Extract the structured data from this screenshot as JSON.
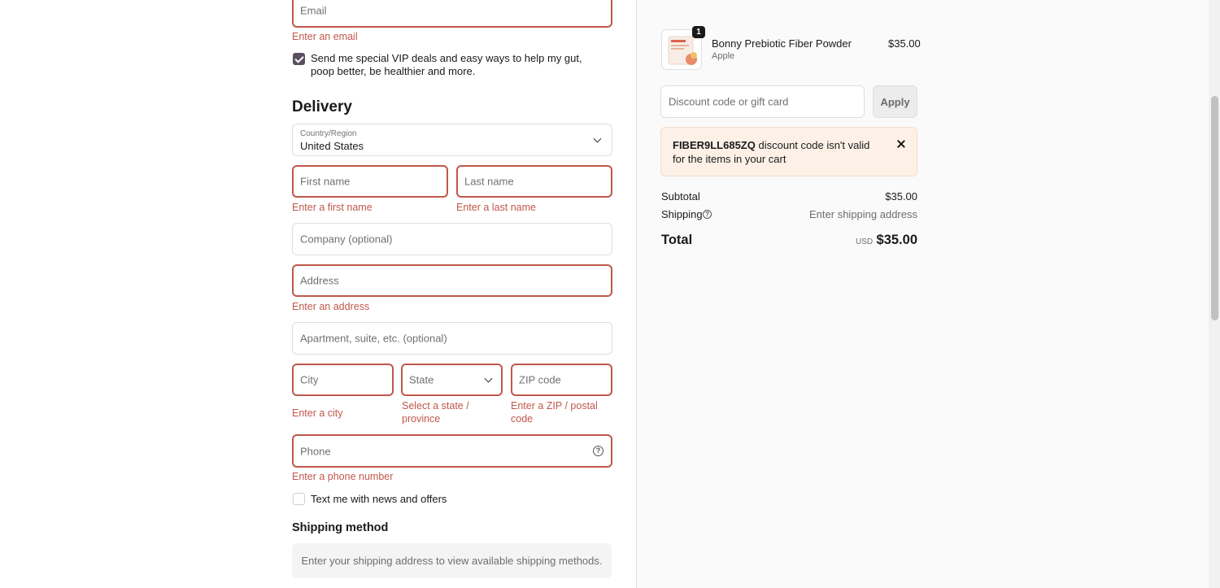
{
  "contact": {
    "email_placeholder": "Email",
    "email_error": "Enter an email",
    "marketing_opt_in": "Send me special VIP deals and easy ways to help my gut, poop better, be healthier and more.",
    "marketing_checked": true
  },
  "delivery": {
    "heading": "Delivery",
    "country_label": "Country/Region",
    "country_value": "United States",
    "first_name_placeholder": "First name",
    "first_name_error": "Enter a first name",
    "last_name_placeholder": "Last name",
    "last_name_error": "Enter a last name",
    "company_placeholder": "Company (optional)",
    "address_placeholder": "Address",
    "address_error": "Enter an address",
    "apartment_placeholder": "Apartment, suite, etc. (optional)",
    "city_placeholder": "City",
    "city_error": "Enter a city",
    "state_placeholder": "State",
    "state_error": "Select a state / province",
    "zip_placeholder": "ZIP code",
    "zip_error": "Enter a ZIP / postal code",
    "phone_placeholder": "Phone",
    "phone_error": "Enter a phone number",
    "sms_opt_in": "Text me with news and offers",
    "sms_checked": false
  },
  "shipping_method": {
    "heading": "Shipping method",
    "message": "Enter your shipping address to view available shipping methods."
  },
  "summary": {
    "item": {
      "quantity": "1",
      "name": "Bonny Prebiotic Fiber Powder",
      "variant": "Apple",
      "price": "$35.00"
    },
    "discount_placeholder": "Discount code or gift card",
    "apply_label": "Apply",
    "notice_code": "FIBER9LL685ZQ",
    "notice_text": "discount code isn't valid for the items in your cart",
    "subtotal_label": "Subtotal",
    "subtotal_value": "$35.00",
    "shipping_label": "Shipping",
    "shipping_value": "Enter shipping address",
    "total_label": "Total",
    "currency": "USD",
    "total_value": "$35.00"
  },
  "colors": {
    "error": "#c0584b",
    "checkbox_checked": "#5a5062",
    "notice_bg": "#fdf1e7"
  }
}
